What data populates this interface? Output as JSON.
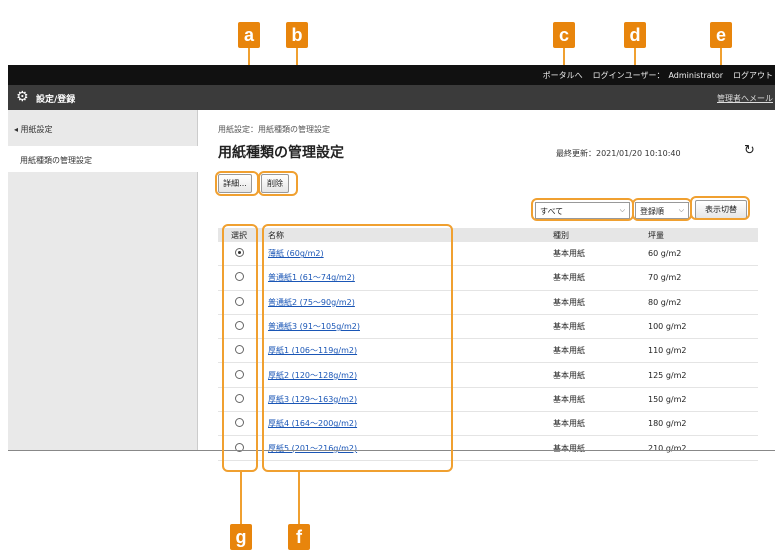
{
  "callouts": {
    "a": "a",
    "b": "b",
    "c": "c",
    "d": "d",
    "e": "e",
    "f": "f",
    "g": "g"
  },
  "topbar": {
    "portal": "ポータルへ",
    "login": "ログインユーザー：　Administrator",
    "logout": "ログアウト"
  },
  "titlebar": {
    "title": "設定/登録",
    "portal_mail": "管理者へメール"
  },
  "sidebar": {
    "back": "◂ 用紙設定",
    "current": "用紙種類の管理設定"
  },
  "main": {
    "breadcrumb": "用紙設定：用紙種類の管理設定",
    "title": "用紙種類の管理設定",
    "updated": "最終更新：2021/01/20 10:10:40"
  },
  "toolbar": {
    "detail_label": "詳細...",
    "delete_label": "削除",
    "display_button": "表示切替"
  },
  "filters": {
    "type_value": "すべて",
    "order_value": "登録順"
  },
  "table": {
    "headers": {
      "select": "選択",
      "name": "名称",
      "type": "種別",
      "weight": "坪量"
    },
    "rows": [
      {
        "name": "薄紙 (60g/m2)",
        "type": "基本用紙",
        "weight": "60 g/m2",
        "selected": true
      },
      {
        "name": "普通紙1 (61～74g/m2)",
        "type": "基本用紙",
        "weight": "70 g/m2",
        "selected": false
      },
      {
        "name": "普通紙2 (75～90g/m2)",
        "type": "基本用紙",
        "weight": "80 g/m2",
        "selected": false
      },
      {
        "name": "普通紙3 (91～105g/m2)",
        "type": "基本用紙",
        "weight": "100 g/m2",
        "selected": false
      },
      {
        "name": "厚紙1 (106～119g/m2)",
        "type": "基本用紙",
        "weight": "110 g/m2",
        "selected": false
      },
      {
        "name": "厚紙2 (120～128g/m2)",
        "type": "基本用紙",
        "weight": "125 g/m2",
        "selected": false
      },
      {
        "name": "厚紙3 (129～163g/m2)",
        "type": "基本用紙",
        "weight": "150 g/m2",
        "selected": false
      },
      {
        "name": "厚紙4 (164～200g/m2)",
        "type": "基本用紙",
        "weight": "180 g/m2",
        "selected": false
      },
      {
        "name": "厚紙5 (201～216g/m2)",
        "type": "基本用紙",
        "weight": "210 g/m2",
        "selected": false
      }
    ]
  },
  "colors": {
    "callout": "#e8850c",
    "callout_outline": "#f0a030",
    "link": "#1a56b6"
  },
  "icons": {
    "settings": "gear-icon",
    "refresh": "refresh-icon",
    "dropdown": "chevron-down-icon"
  }
}
